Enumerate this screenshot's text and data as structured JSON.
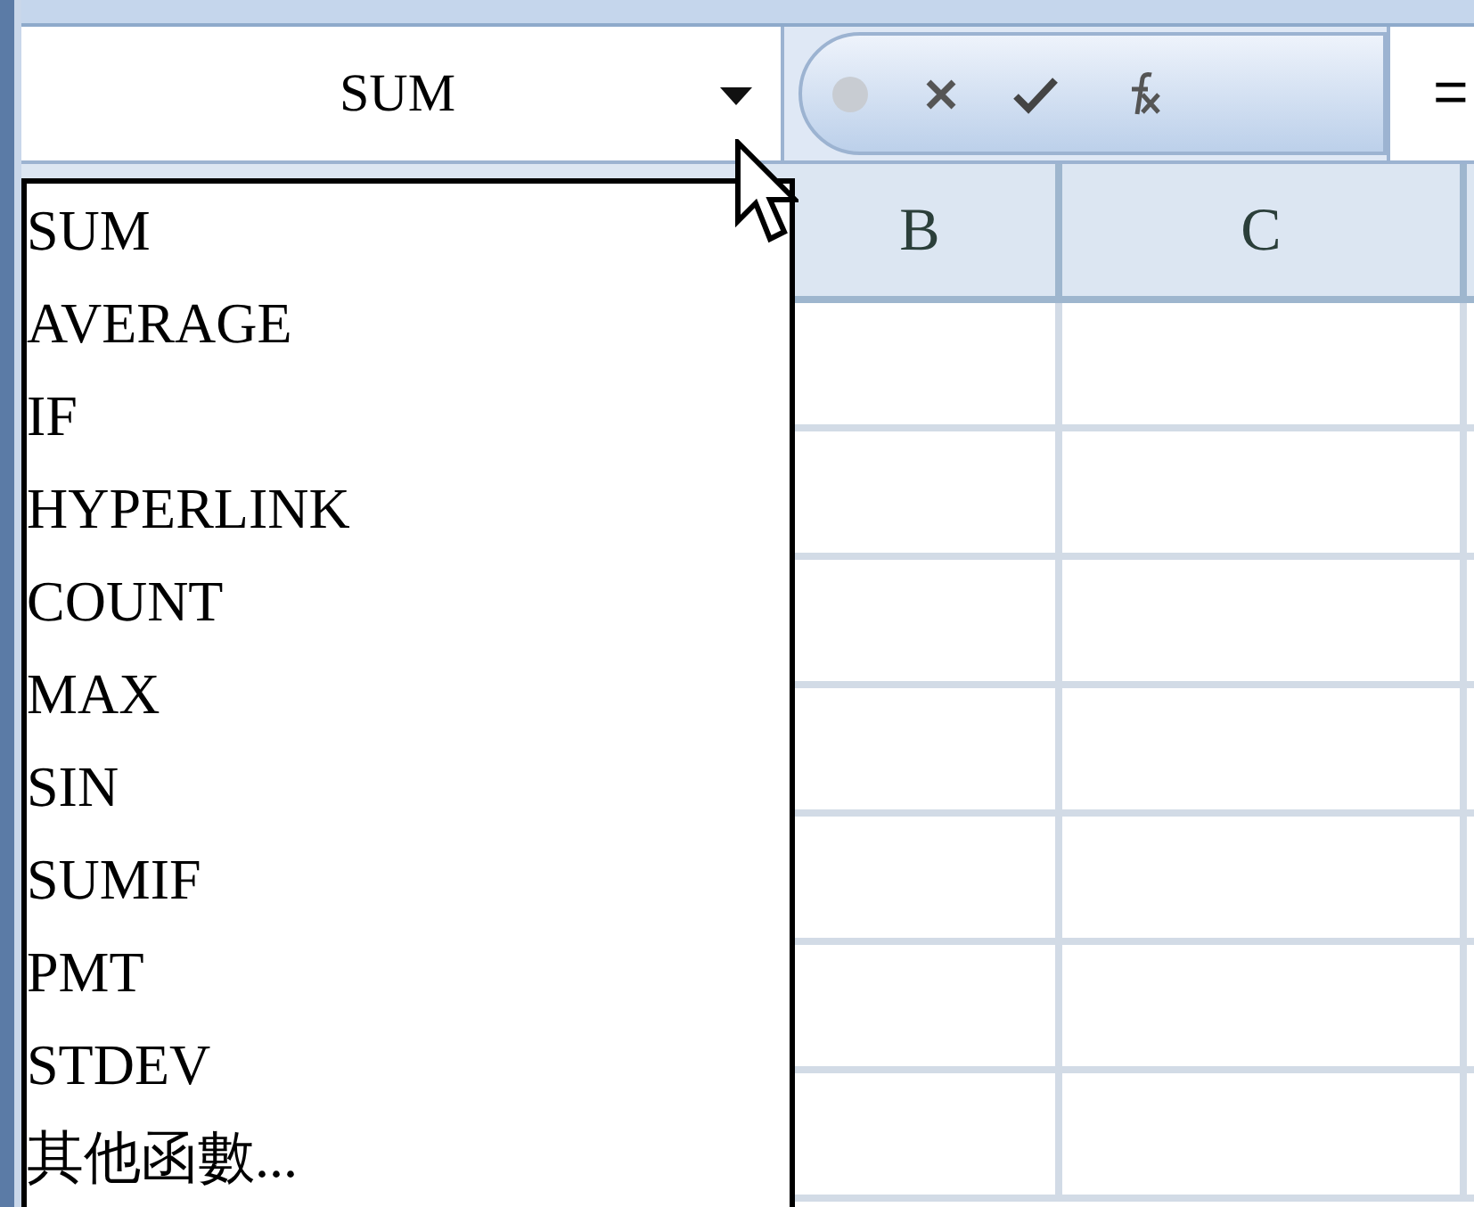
{
  "name_box": {
    "value": "SUM"
  },
  "formula_bar": {
    "value": "="
  },
  "columns": [
    "B",
    "C"
  ],
  "function_list": {
    "items": [
      "SUM",
      "AVERAGE",
      "IF",
      "HYPERLINK",
      "COUNT",
      "MAX",
      "SIN",
      "SUMIF",
      "PMT",
      "STDEV",
      "其他函數..."
    ]
  }
}
